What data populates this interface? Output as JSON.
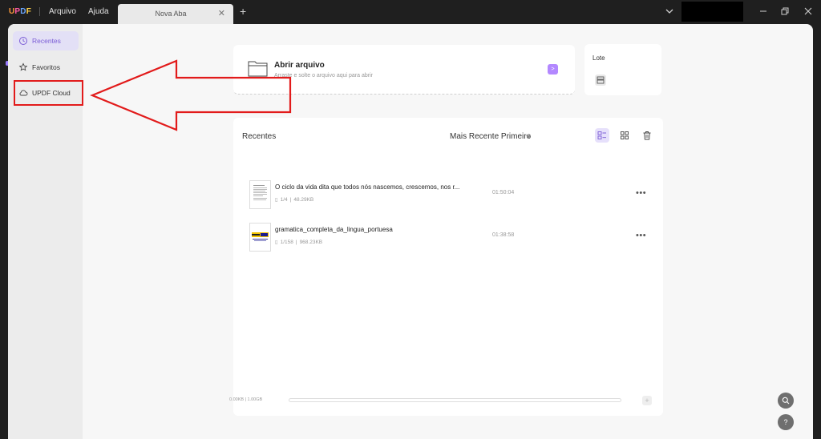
{
  "titlebar": {
    "logo": "UPDF",
    "menu": {
      "file": "Arquivo",
      "help": "Ajuda"
    },
    "tab_title": "Nova Aba",
    "tab_close": "✕",
    "tab_add": "+"
  },
  "sidebar": {
    "items": [
      {
        "label": "Recentes",
        "icon": "clock-icon",
        "active": true
      },
      {
        "label": "Favoritos",
        "icon": "star-icon",
        "active": false
      },
      {
        "label": "UPDF Cloud",
        "icon": "cloud-icon",
        "active": false
      }
    ]
  },
  "open_file": {
    "title": "Abrir arquivo",
    "subtitle": "Arraste e solte o arquivo aqui para abrir",
    "button": ">"
  },
  "batch": {
    "title": "Lote"
  },
  "recent": {
    "title": "Recentes",
    "sort": "Mais Recente Primeiro",
    "files": [
      {
        "name": "O ciclo da vida dita que todos nós nascemos, crescemos, nos r...",
        "pages": "1/4",
        "size": "48.29KB",
        "time": "01:50:04",
        "more": "•••"
      },
      {
        "name": "gramatica_completa_da_lingua_portuesa",
        "pages": "1/158",
        "size": "968.23KB",
        "time": "01:38:58",
        "more": "•••"
      }
    ]
  },
  "storage": {
    "label": "0.00KB | 1.00GB",
    "used_fraction": 0.0,
    "add": "+"
  },
  "floating": {
    "search": "search-icon",
    "help": "?"
  },
  "colors": {
    "accent": "#7b5cd6",
    "annotation": "#e21b1b",
    "background": "#1f1f1f"
  }
}
